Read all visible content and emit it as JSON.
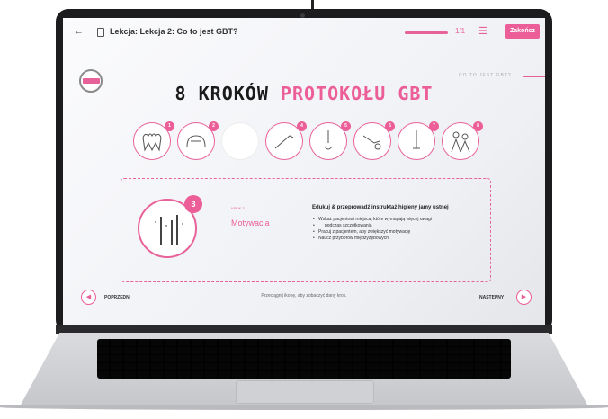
{
  "header": {
    "back_icon": "arrow-left-icon",
    "lesson_icon": "document-icon",
    "breadcrumb": "Lekcja: Lekcja 2: Co to jest GBT?",
    "progress": 1.0,
    "page_counter": "1/1",
    "menu_icon": "list-icon",
    "finish_label": "Zakończ"
  },
  "logo": {
    "name": "brand-seal-logo"
  },
  "corner_label": "CO TO JEST GBT?",
  "title": {
    "part1": "8 KROKÓW ",
    "part2": "PROTOKOŁU GBT"
  },
  "steps": [
    {
      "number": "1",
      "icon": "teeth-icon"
    },
    {
      "number": "2",
      "icon": "molar-brushing-icon"
    },
    {
      "number": "",
      "icon": ""
    },
    {
      "number": "4",
      "icon": "airflow-nozzle-icon"
    },
    {
      "number": "5",
      "icon": "perioflow-icon"
    },
    {
      "number": "6",
      "icon": "ultrasonic-scaler-icon"
    },
    {
      "number": "7",
      "icon": "scaler-instrument-icon"
    },
    {
      "number": "8",
      "icon": "recall-people-icon"
    }
  ],
  "detail": {
    "number": "3",
    "icon": "toothbrushes-icon",
    "step_label": "KROK 3",
    "step_name": "Motywacja",
    "desc_title": "Edukuj & przeprowadź instruktaż higieny jamy ustnej",
    "bullets": [
      "Wskaż pacjentowi miejsca, które wymagają więcej uwagi",
      "   podczas szczotkowania",
      "Pracuj z pacjentem, aby zwiększyć motywację",
      "Naucz przyborów międzyzębowych."
    ]
  },
  "nav": {
    "prev_label": "POPRZEDNI",
    "next_label": "NASTĘPNY",
    "hint": "Przeciągnij ikonę, aby zobaczyć dany krok."
  },
  "colors": {
    "accent": "#ec5e98",
    "text": "#1a1a1a"
  }
}
